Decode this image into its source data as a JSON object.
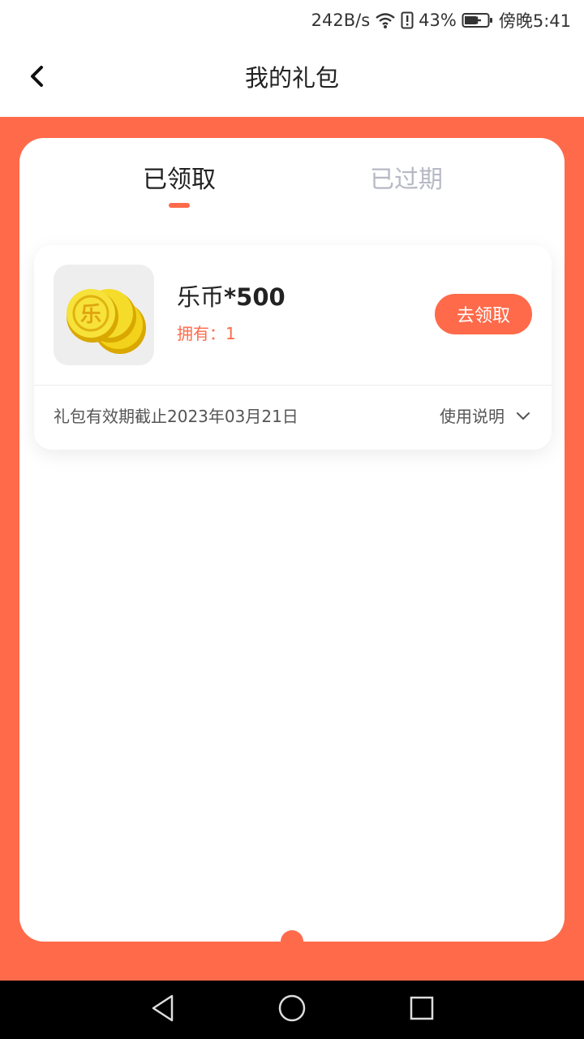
{
  "status_bar": {
    "speed": "242B/s",
    "battery": "43%",
    "time": "傍晚5:41"
  },
  "header": {
    "title": "我的礼包"
  },
  "tabs": [
    {
      "label": "已领取",
      "active": true
    },
    {
      "label": "已过期",
      "active": false
    }
  ],
  "gift": {
    "name": "乐币",
    "qty": "*500",
    "owned": "拥有：1",
    "coin_char": "乐",
    "claim_label": "去领取",
    "expiry": "礼包有效期截止2023年03月21日",
    "usage_label": "使用说明"
  },
  "colors": {
    "accent": "#ff6a4a",
    "tab_inactive": "#b6b9c4",
    "coin": "#f2d21a"
  },
  "icons": {
    "back": "chevron-left-icon",
    "usage_toggle": "chevron-down-icon",
    "gift_image": "gold-coins-icon",
    "nav": [
      "nav-back-icon",
      "nav-home-icon",
      "nav-recent-icon"
    ]
  }
}
